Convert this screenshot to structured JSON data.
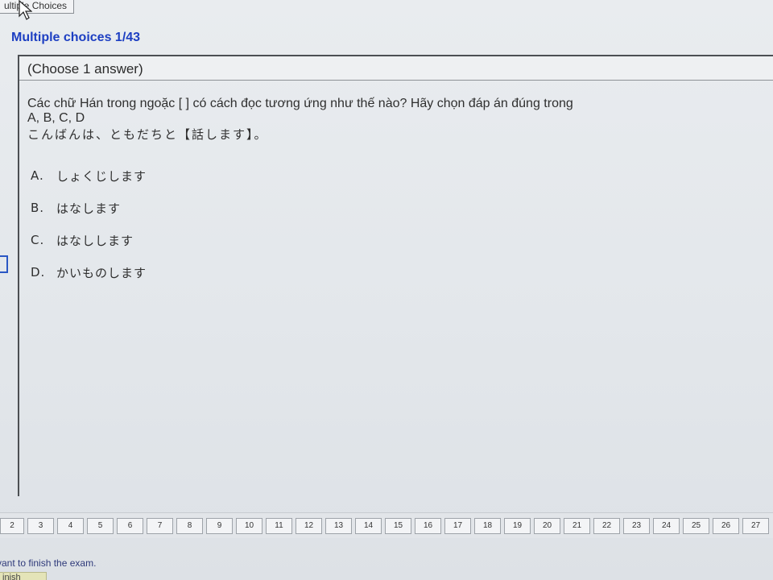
{
  "tab": {
    "label": "ultiple Choices"
  },
  "section": {
    "title": "Multiple choices 1/43"
  },
  "question": {
    "instruction": "(Choose 1 answer)",
    "text_line1": "Các chữ Hán trong ngoặc [    ]  có cách đọc tương ứng như thế nào? Hãy chọn đáp án đúng trong",
    "text_line2": "A, B, C, D",
    "sentence": "こんばんは、ともだちと【話します】。"
  },
  "options": [
    {
      "letter": "A.",
      "text": "しょくじします"
    },
    {
      "letter": "B.",
      "text": "はなします"
    },
    {
      "letter": "C.",
      "text": "はなしします"
    },
    {
      "letter": "D.",
      "text": "かいものします"
    }
  ],
  "nav": {
    "pages": [
      "2",
      "3",
      "4",
      "5",
      "6",
      "7",
      "8",
      "9",
      "10",
      "11",
      "12",
      "13",
      "14",
      "15",
      "16",
      "17",
      "18",
      "19",
      "20",
      "21",
      "22",
      "23",
      "24",
      "25",
      "26",
      "27"
    ]
  },
  "footer": {
    "finish_text": "vant to finish the exam.",
    "finish_button": "inish"
  },
  "icons": {
    "cursor": "mouse-pointer-icon"
  },
  "colors": {
    "title_blue": "#1d3fc2",
    "radio_blue": "#2a57c4"
  }
}
